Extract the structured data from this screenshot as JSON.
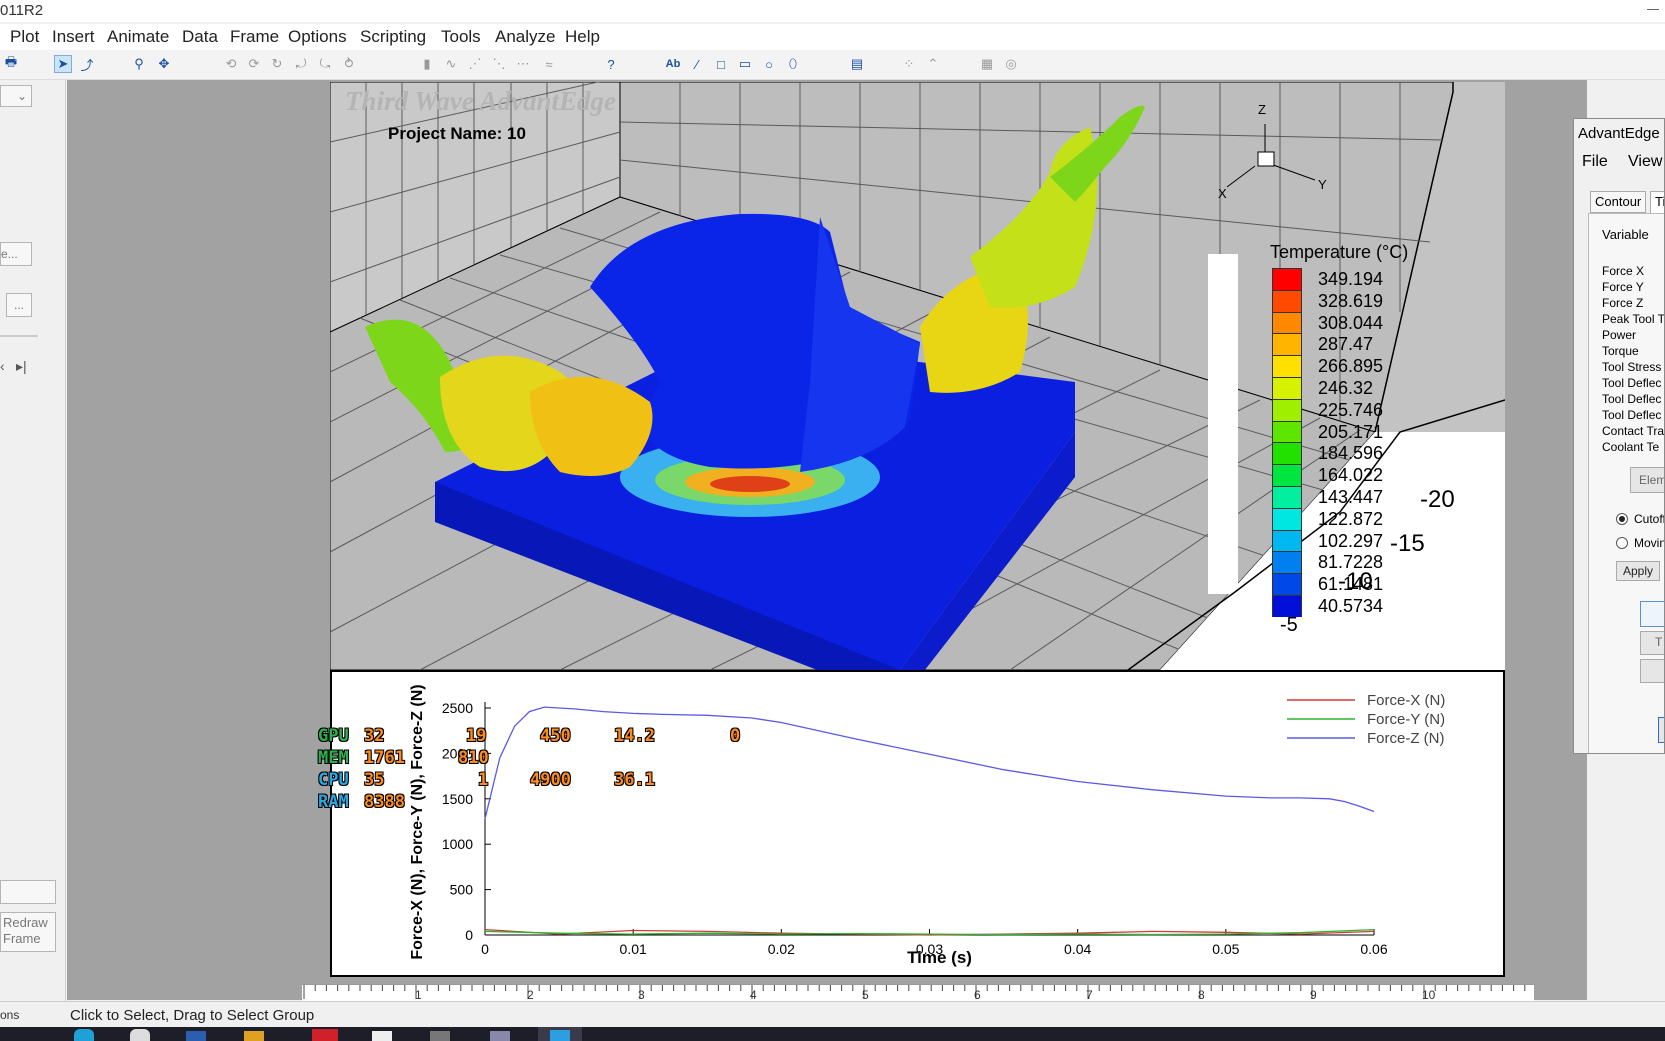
{
  "window": {
    "title": "011R2"
  },
  "menu": [
    "Plot",
    "Insert",
    "Animate",
    "Data",
    "Frame",
    "Options",
    "Scripting",
    "Tools",
    "Analyze",
    "Help"
  ],
  "plot3d": {
    "watermark": "Third Wave AdvantEdge",
    "project_label": "Project Name: 10",
    "axes": {
      "z": "Z",
      "y": "Y",
      "x": "X"
    },
    "side_ticks": [
      "-20",
      "-15",
      "-10",
      "-5"
    ],
    "legend": {
      "title": "Temperature (°C)",
      "values": [
        "349.194",
        "328.619",
        "308.044",
        "287.47",
        "266.895",
        "246.32",
        "225.746",
        "205.171",
        "184.596",
        "164.022",
        "143.447",
        "122.872",
        "102.297",
        "81.7228",
        "61.1481",
        "40.5734"
      ],
      "colors": [
        "#ff0000",
        "#ff4a00",
        "#ff8800",
        "#ffb400",
        "#ffe000",
        "#d6f200",
        "#9ef000",
        "#5ee600",
        "#22e000",
        "#00e640",
        "#00f0a0",
        "#00e6e0",
        "#00b8f0",
        "#0080f0",
        "#0048e8",
        "#0010d8"
      ]
    }
  },
  "chart_data": {
    "type": "line",
    "xlabel": "Time (s)",
    "ylabel": "Force-X (N), Force-Y (N), Force-Z (N)",
    "xlim": [
      0,
      0.06
    ],
    "ylim": [
      0,
      2500
    ],
    "xticks": [
      "0",
      "0.01",
      "0.02",
      "0.03",
      "0.04",
      "0.05",
      "0.06"
    ],
    "yticks": [
      "0",
      "500",
      "1000",
      "1500",
      "2000",
      "2500"
    ],
    "legend_position": "top-right",
    "series": [
      {
        "name": "Force-X (N)",
        "color": "#d43a3a",
        "x": [
          0,
          0.005,
          0.01,
          0.015,
          0.02,
          0.025,
          0.03,
          0.035,
          0.04,
          0.045,
          0.05,
          0.055,
          0.06
        ],
        "y": [
          60,
          10,
          50,
          40,
          20,
          10,
          0,
          10,
          20,
          40,
          30,
          10,
          40
        ]
      },
      {
        "name": "Force-Y (N)",
        "color": "#2ab52a",
        "x": [
          0,
          0.005,
          0.01,
          0.015,
          0.02,
          0.025,
          0.03,
          0.035,
          0.04,
          0.045,
          0.05,
          0.055,
          0.06
        ],
        "y": [
          40,
          20,
          10,
          20,
          10,
          15,
          10,
          5,
          10,
          5,
          10,
          25,
          60
        ]
      },
      {
        "name": "Force-Z (N)",
        "color": "#5a5ae6",
        "x": [
          0,
          0.001,
          0.002,
          0.003,
          0.004,
          0.006,
          0.008,
          0.01,
          0.012,
          0.015,
          0.018,
          0.02,
          0.025,
          0.03,
          0.035,
          0.04,
          0.045,
          0.05,
          0.053,
          0.055,
          0.057,
          0.058,
          0.059,
          0.06
        ],
        "y": [
          1280,
          1950,
          2300,
          2460,
          2510,
          2490,
          2460,
          2440,
          2430,
          2420,
          2390,
          2340,
          2160,
          1990,
          1820,
          1690,
          1600,
          1530,
          1510,
          1510,
          1500,
          1470,
          1420,
          1360
        ]
      }
    ]
  },
  "hud": {
    "gpu_label": "GPU",
    "gpu_load": "32",
    "gpu_usage": "19",
    "gpu_clock": "450",
    "gpu_temp": "14.2",
    "gpu_extra": "0",
    "mem_label": "MEM",
    "mem_value": "1761",
    "mem_clock": "810",
    "cpu_label": "CPU",
    "cpu_value": "35",
    "cpu_usage": "1",
    "cpu_clock": "4900",
    "cpu_temp": "36.1",
    "ram_label": "RAM",
    "ram_value": "8388"
  },
  "ruler": [
    "1",
    "2",
    "3",
    "4",
    "5",
    "6",
    "7",
    "8",
    "9",
    "10"
  ],
  "status": {
    "message": "Click to Select, Drag to Select Group",
    "left": "ons"
  },
  "sidebar": {
    "redraw": "Redraw Frame",
    "dots": "...",
    "browse": "e..."
  },
  "dialog": {
    "title": "AdvantEdge",
    "menu": [
      "File",
      "View"
    ],
    "tabs": [
      "Contour",
      "Ti"
    ],
    "variable_label": "Variable",
    "variables": [
      "Force X",
      "Force Y",
      "Force Z",
      "Peak Tool T",
      "Power",
      "Torque",
      "Tool Stress",
      "Tool Deflec",
      "Tool Deflec",
      "Tool Deflec",
      "Contact Tra",
      "Coolant Te"
    ],
    "element_button": "Elem",
    "radio_cutoff": "Cutoff",
    "radio_moving": "Moving",
    "apply": "Apply",
    "t_button": "T"
  }
}
